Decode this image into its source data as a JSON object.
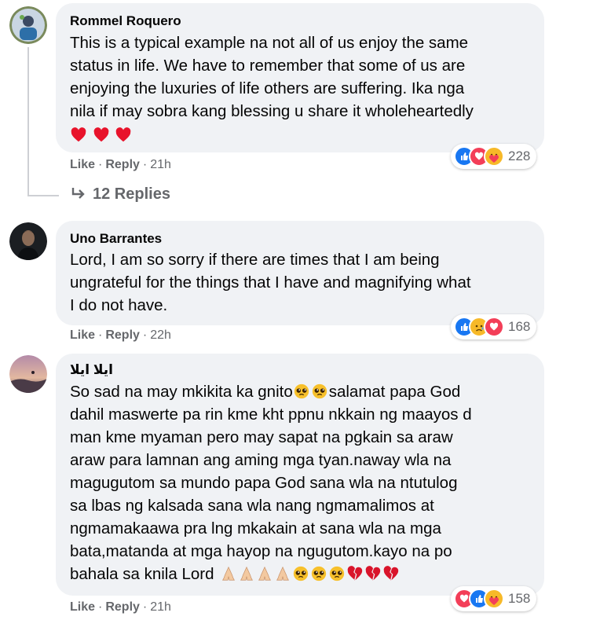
{
  "comments": [
    {
      "author": "Rommel Roquero",
      "lines": [
        "This is a typical example na not all of us enjoy the same",
        "status in life. We have to remember that some of us are",
        "enjoying the luxuries of life others are suffering. Ika nga",
        "nila if may sobra kang blessing u share it wholeheartedly"
      ],
      "emoji_line": [
        "red-heart",
        "red-heart",
        "red-heart"
      ],
      "actions": {
        "like": "Like",
        "reply": "Reply",
        "time": "21h"
      },
      "reactions": {
        "icons": [
          "like",
          "love",
          "care"
        ],
        "count": "228"
      },
      "replies": "12 Replies"
    },
    {
      "author": "Uno Barrantes",
      "lines": [
        "Lord, I am so sorry if there are times that I am being",
        "ungrateful for the things that I have and magnifying what",
        "I do not have."
      ],
      "actions": {
        "like": "Like",
        "reply": "Reply",
        "time": "22h"
      },
      "reactions": {
        "icons": [
          "like",
          "sad",
          "love"
        ],
        "count": "168"
      }
    },
    {
      "author": "ايلا ايلا",
      "line1_text_a": "So sad na may mkikita ka gnito",
      "line1_text_b": "salamat papa God",
      "lines": [
        "dahil maswerte pa rin kme kht ppnu nkkain ng maayos d",
        "man kme myaman pero may sapat na pgkain sa araw",
        "araw para lamnan ang aming mga tyan.naway wla na",
        "magugutom sa mundo papa God sana wla na ntutulog",
        "sa lbas ng kalsada sana wla nang ngmamalimos at",
        "ngmamakaawa pra lng mkakain at sana wla na mga",
        "bata,matanda at mga hayop na ngugutom.kayo na po"
      ],
      "last_line_text": "bahala sa knila Lord",
      "last_line_emojis": [
        "folded-hands",
        "folded-hands",
        "folded-hands",
        "folded-hands",
        "pleading-face",
        "pleading-face",
        "pleading-face",
        "broken-heart",
        "broken-heart",
        "broken-heart"
      ],
      "actions": {
        "like": "Like",
        "reply": "Reply",
        "time": "21h"
      },
      "reactions": {
        "icons": [
          "love",
          "like",
          "care"
        ],
        "count": "158"
      }
    }
  ],
  "colors": {
    "bubble": "#f0f2f5",
    "meta": "#65676b",
    "like_blue": "#1877f2",
    "love_red": "#f33e58"
  }
}
